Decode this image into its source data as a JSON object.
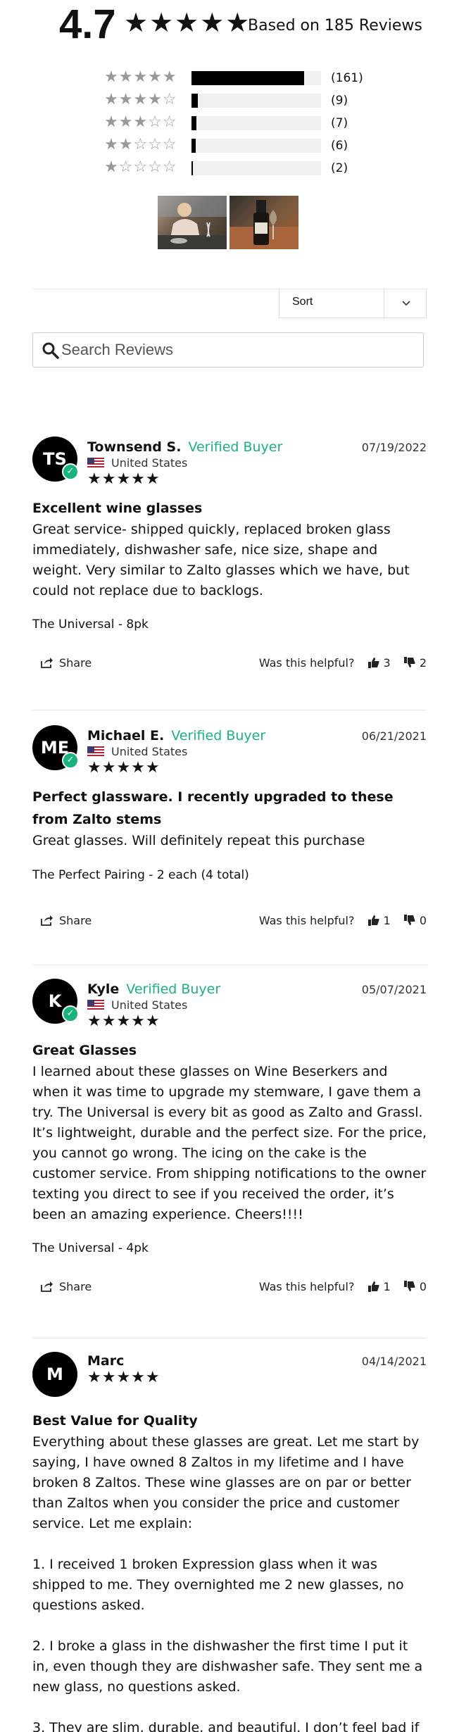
{
  "summary": {
    "average": "4.7",
    "stars": "★★★★★",
    "based_on": "Based on 185 Reviews"
  },
  "histogram": [
    {
      "stars": "★★★★★",
      "count": "(161)",
      "fraction": 0.87
    },
    {
      "stars": "★★★★☆",
      "count": "(9)",
      "fraction": 0.05
    },
    {
      "stars": "★★★☆☆",
      "count": "(7)",
      "fraction": 0.04
    },
    {
      "stars": "★★☆☆☆",
      "count": "(6)",
      "fraction": 0.03
    },
    {
      "stars": "★☆☆☆☆",
      "count": "(2)",
      "fraction": 0.01
    }
  ],
  "toolbar": {
    "sort_label": "Sort",
    "search_placeholder": "Search Reviews"
  },
  "actions": {
    "share_label": "Share",
    "helpful_label": "Was this helpful?"
  },
  "reviews": [
    {
      "initials": "TS",
      "name": "Townsend S.",
      "verified": "Verified Buyer",
      "country": "United States",
      "date": "07/19/2022",
      "stars": "★★★★★",
      "title": "Excellent wine glasses",
      "body": "Great service- shipped quickly, replaced broken glass immediately, dishwasher safe, nice size, shape and weight. Very similar to Zalto glasses which we have, but could not replace due to backlogs.",
      "product": "The Universal - 8pk",
      "up": "3",
      "down": "2"
    },
    {
      "initials": "ME",
      "name": "Michael E.",
      "verified": "Verified Buyer",
      "country": "United States",
      "date": "06/21/2021",
      "stars": "★★★★★",
      "title": "Perfect glassware. I recently upgraded to these from Zalto stems",
      "body": "Great glasses. Will definitely repeat this purchase",
      "product": "The Perfect Pairing - 2 each (4 total)",
      "up": "1",
      "down": "0"
    },
    {
      "initials": "K",
      "name": "Kyle",
      "verified": "Verified Buyer",
      "country": "United States",
      "date": "05/07/2021",
      "stars": "★★★★★",
      "title": "Great Glasses",
      "body": "I learned about these glasses on Wine Beserkers and when it was time to upgrade my stemware, I gave them a try. The Universal is every bit as good as Zalto and Grassl. It’s lightweight, durable and the perfect size. For the price, you cannot go wrong. The icing on the cake is the customer service. From shipping notifications to the owner texting you direct to see if you received the order, it’s been an amazing experience. Cheers!!!!",
      "product": "The Universal - 4pk",
      "up": "1",
      "down": "0"
    },
    {
      "initials": "M",
      "name": "Marc",
      "date": "04/14/2021",
      "stars": "★★★★★",
      "title": "Best Value for Quality",
      "body": "Everything about these glasses are great. Let me start by saying, I have owned 8 Zaltos in my lifetime and I have broken 8 Zaltos. These wine glasses are on par or better than Zaltos when you consider the price and customer service. Let me explain:\n\n1. I received 1 broken Expression glass when it was shipped to me. They overnighted me 2 new glasses, no questions asked.\n\n2. I broke a glass in the dishwasher the first time I put it in, even though they are dishwasher safe. They sent me a new glass, no questions asked.\n\n3. They are slim, durable, and beautiful. I don’t feel bad if I break one because it’s not breaking the bank ( ok I still feel"
    }
  ]
}
